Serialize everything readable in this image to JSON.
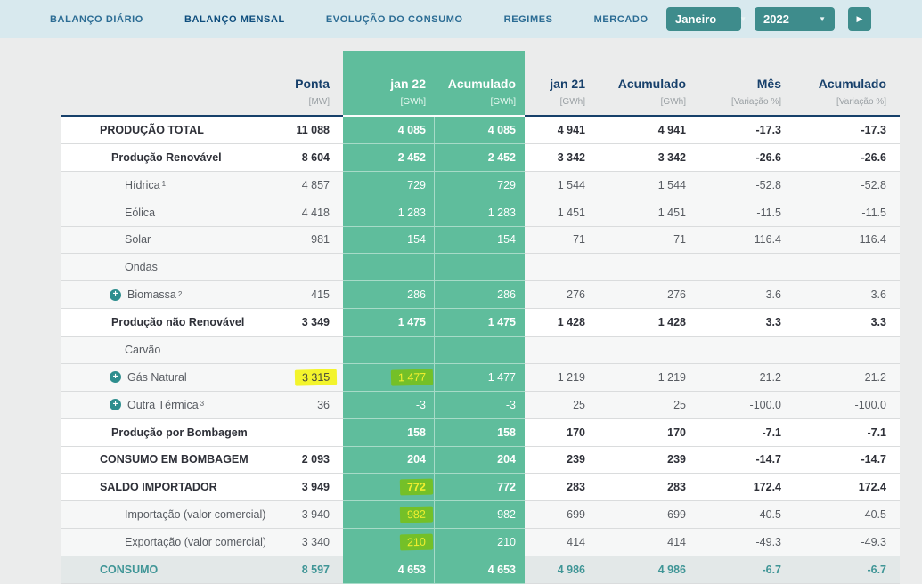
{
  "nav": {
    "tabs": [
      {
        "label": "Balanço Diário",
        "active": false
      },
      {
        "label": "Balanço Mensal",
        "active": true
      },
      {
        "label": "Evolução do Consumo",
        "active": false
      },
      {
        "label": "Regimes",
        "active": false
      },
      {
        "label": "Mercado",
        "active": false
      }
    ],
    "month_select": "Janeiro",
    "year_select": "2022",
    "caret_icon": "▼",
    "next_icon": "▶"
  },
  "table": {
    "columns": [
      {
        "label": "Ponta",
        "unit": "[MW]",
        "variant": "plain"
      },
      {
        "label": "jan 22",
        "unit": "[GWh]",
        "variant": "green"
      },
      {
        "label": "Acumulado",
        "unit": "[GWh]",
        "variant": "green"
      },
      {
        "label": "jan 21",
        "unit": "[GWh]",
        "variant": "plain"
      },
      {
        "label": "Acumulado",
        "unit": "[GWh]",
        "variant": "plain"
      },
      {
        "label": "Mês",
        "unit": "[Variação %]",
        "variant": "plain"
      },
      {
        "label": "Acumulado",
        "unit": "[Variação %]",
        "variant": "plain"
      }
    ],
    "rows": [
      {
        "label": "PRODUÇÃO TOTAL",
        "level": 1,
        "style": "bold",
        "values": [
          "11 088",
          "4 085",
          "4 085",
          "4 941",
          "4 941",
          "-17.3",
          "-17.3"
        ]
      },
      {
        "label": "Produção Renovável",
        "level": 2,
        "style": "bold",
        "values": [
          "8 604",
          "2 452",
          "2 452",
          "3 342",
          "3 342",
          "-26.6",
          "-26.6"
        ]
      },
      {
        "label": "Hídrica",
        "sup": "1",
        "level": 3,
        "style": "normal",
        "values": [
          "4 857",
          "729",
          "729",
          "1 544",
          "1 544",
          "-52.8",
          "-52.8"
        ]
      },
      {
        "label": "Eólica",
        "level": 3,
        "style": "normal",
        "values": [
          "4 418",
          "1 283",
          "1 283",
          "1 451",
          "1 451",
          "-11.5",
          "-11.5"
        ]
      },
      {
        "label": "Solar",
        "level": 3,
        "style": "normal",
        "values": [
          "981",
          "154",
          "154",
          "71",
          "71",
          "116.4",
          "116.4"
        ]
      },
      {
        "label": "Ondas",
        "level": 3,
        "style": "normal",
        "values": [
          "",
          "",
          "",
          "",
          "",
          "",
          ""
        ]
      },
      {
        "label": "Biomassa",
        "sup": "2",
        "expand": true,
        "level": 3,
        "style": "normal",
        "values": [
          "415",
          "286",
          "286",
          "276",
          "276",
          "3.6",
          "3.6"
        ]
      },
      {
        "label": "Produção não Renovável",
        "level": 2,
        "style": "bold",
        "values": [
          "3 349",
          "1 475",
          "1 475",
          "1 428",
          "1 428",
          "3.3",
          "3.3"
        ]
      },
      {
        "label": "Carvão",
        "level": 3,
        "style": "normal",
        "values": [
          "",
          "",
          "",
          "",
          "",
          "",
          ""
        ]
      },
      {
        "label": "Gás Natural",
        "expand": true,
        "level": 3,
        "style": "normal",
        "values": [
          "3 315",
          "1 477",
          "1 477",
          "1 219",
          "1 219",
          "21.2",
          "21.2"
        ],
        "highlights": [
          0,
          1
        ]
      },
      {
        "label": "Outra Térmica",
        "sup": "3",
        "expand": true,
        "level": 3,
        "style": "normal",
        "values": [
          "36",
          "-3",
          "-3",
          "25",
          "25",
          "-100.0",
          "-100.0"
        ]
      },
      {
        "label": "Produção por Bombagem",
        "level": 2,
        "style": "bold",
        "values": [
          "",
          "158",
          "158",
          "170",
          "170",
          "-7.1",
          "-7.1"
        ]
      },
      {
        "label": "CONSUMO EM BOMBAGEM",
        "level": 1,
        "style": "bold",
        "values": [
          "2 093",
          "204",
          "204",
          "239",
          "239",
          "-14.7",
          "-14.7"
        ]
      },
      {
        "label": "SALDO IMPORTADOR",
        "level": 1,
        "style": "bold",
        "values": [
          "3 949",
          "772",
          "772",
          "283",
          "283",
          "172.4",
          "172.4"
        ],
        "highlights": [
          1
        ]
      },
      {
        "label": "Importação (valor comercial)",
        "level": 3,
        "style": "normal",
        "values": [
          "3 940",
          "982",
          "982",
          "699",
          "699",
          "40.5",
          "40.5"
        ],
        "highlights": [
          1
        ]
      },
      {
        "label": "Exportação (valor comercial)",
        "level": 3,
        "style": "normal",
        "values": [
          "3 340",
          "210",
          "210",
          "414",
          "414",
          "-49.3",
          "-49.3"
        ],
        "highlights": [
          1
        ]
      },
      {
        "label": "CONSUMO",
        "level": 1,
        "style": "consumo",
        "values": [
          "8 597",
          "4 653",
          "4 653",
          "4 986",
          "4 986",
          "-6.7",
          "-6.7"
        ]
      }
    ]
  },
  "colors": {
    "nav_background": "#d8e9ee",
    "teal_button": "#3e8c8c",
    "green_column": "#5fbd9c",
    "header_navy": "#17406b",
    "highlight_yellow": "#f3f42c",
    "highlight_green_blend": "#74c028",
    "consumo_teal": "#3f9596",
    "page_background": "#ebecec"
  }
}
